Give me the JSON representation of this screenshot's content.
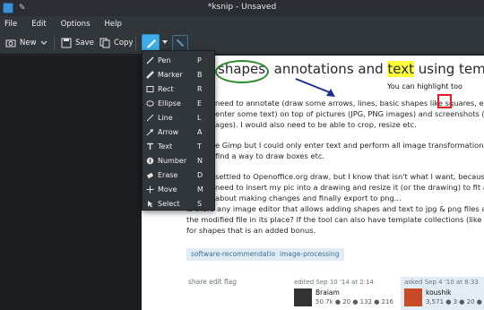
{
  "window": {
    "title": "*ksnip - Unsaved"
  },
  "menubar": {
    "items": [
      "File",
      "Edit",
      "Options",
      "Help"
    ]
  },
  "toolbar": {
    "new_label": "New",
    "save_label": "Save",
    "copy_label": "Copy"
  },
  "tool_menu": {
    "items": [
      {
        "label": "Pen",
        "key": "P",
        "icon": "pen-icon"
      },
      {
        "label": "Marker",
        "key": "B",
        "icon": "marker-icon"
      },
      {
        "label": "Rect",
        "key": "R",
        "icon": "rect-icon"
      },
      {
        "label": "Ellipse",
        "key": "E",
        "icon": "ellipse-icon"
      },
      {
        "label": "Line",
        "key": "L",
        "icon": "line-icon"
      },
      {
        "label": "Arrow",
        "key": "A",
        "icon": "arrow-icon"
      },
      {
        "label": "Text",
        "key": "T",
        "icon": "text-icon"
      },
      {
        "label": "Number",
        "key": "N",
        "icon": "number-icon"
      },
      {
        "label": "Erase",
        "key": "D",
        "icon": "erase-icon"
      },
      {
        "label": "Move",
        "key": "M",
        "icon": "move-icon"
      },
      {
        "label": "Select",
        "key": "S",
        "icon": "select-icon"
      }
    ]
  },
  "screenshot": {
    "title_pre": "shapes",
    "title_mid": ", annotations and ",
    "title_hl": "text",
    "title_post": " using templates",
    "hint": "You can highlight too",
    "lines": [
      "need to annotate (draw some arrows, lines, basic shapes like squares, elli",
      "enter some text) on top of pictures (JPG, PNG images) and screenshots (",
      "ages). I would also need to be able to crop, resize etc.",
      "",
      "e Gimp but I could only enter text and perform all image transformations l",
      "find a way to draw boxes etc.",
      "",
      "settled to Openoffice.org draw, but I know that isn't what I want, because i",
      " need to insert my pic into a drawing and resize it (or the drawing) to fit a",
      "about making changes and finally export to png...",
      "Is there any image editor that allows adding shapes and text to jpg & png files and",
      "the modified file in its place? If the tool can also have template collections (like dia",
      "for shapes that is an added bonus."
    ],
    "tags": [
      "software-recommendation",
      "image-processing"
    ],
    "post_links": "share  edit  flag",
    "edited": {
      "meta": "edited Sep 10 '14 at 2:14",
      "user": "Braiam",
      "rep": "50.7k  ● 20  ● 132  ● 216"
    },
    "asked": {
      "meta": "asked Sep 4 '10 at 8:33",
      "user": "koushik",
      "rep": "3,571  ● 3  ● 20  ● 19"
    }
  },
  "colors": {
    "accent": "#3daee9",
    "highlight": "#ffff3a",
    "ellipse": "#2e8b2e",
    "rect": "#e02020",
    "arrow": "#1f2f8f"
  }
}
